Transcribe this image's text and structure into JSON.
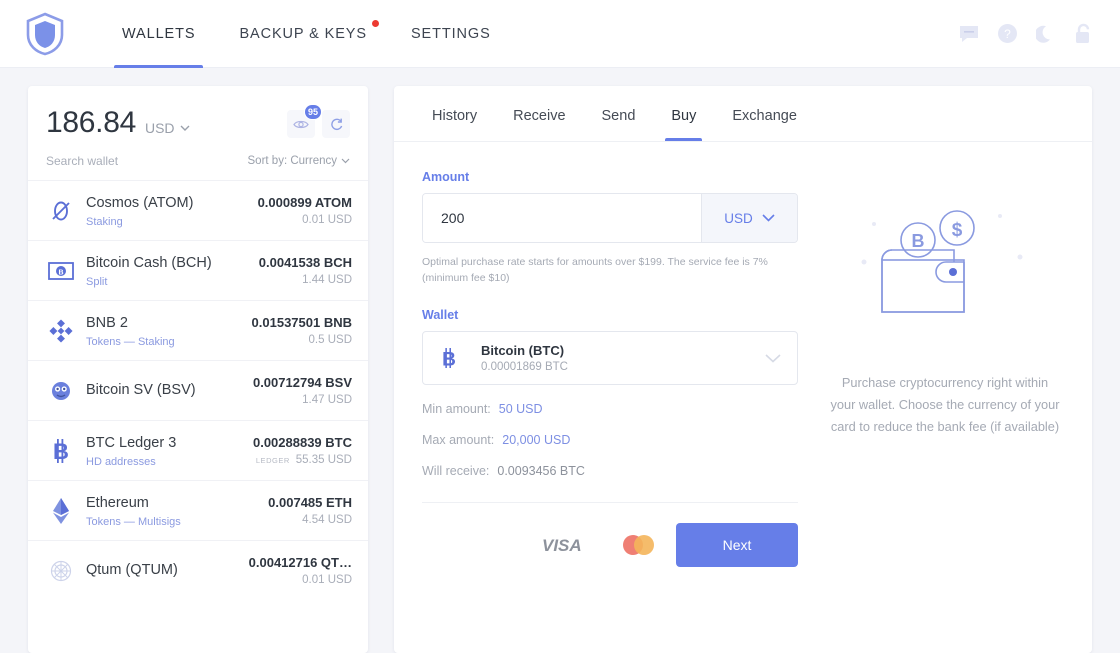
{
  "header": {
    "logo_name": "shield-logo",
    "nav": [
      {
        "label": "WALLETS",
        "active": true,
        "dot": false
      },
      {
        "label": "BACKUP & KEYS",
        "active": false,
        "dot": true
      },
      {
        "label": "SETTINGS",
        "active": false,
        "dot": false
      }
    ],
    "icons": [
      "chat-icon",
      "help-icon",
      "moon-icon",
      "unlock-icon"
    ]
  },
  "sidebar": {
    "balance": "186.84",
    "balance_currency": "USD",
    "eye_badge": "95",
    "search_placeholder": "Search wallet",
    "sort_label": "Sort by: Currency",
    "wallets": [
      {
        "icon": "cosmos-icon",
        "name": "Cosmos (ATOM)",
        "sub": "Staking",
        "amount": "0.000899 ATOM",
        "usd": "0.01 USD",
        "tag": ""
      },
      {
        "icon": "bitcoin-cash-icon",
        "name": "Bitcoin Cash (BCH)",
        "sub": "Split",
        "amount": "0.0041538 BCH",
        "usd": "1.44 USD",
        "tag": ""
      },
      {
        "icon": "binance-icon",
        "name": "BNB 2",
        "sub": "Tokens — Staking",
        "amount": "0.01537501 BNB",
        "usd": "0.5 USD",
        "tag": ""
      },
      {
        "icon": "bitcoin-sv-icon",
        "name": "Bitcoin SV (BSV)",
        "sub": "",
        "amount": "0.00712794 BSV",
        "usd": "1.47 USD",
        "tag": ""
      },
      {
        "icon": "bitcoin-icon",
        "name": "BTC Ledger 3",
        "sub": "HD addresses",
        "amount": "0.00288839 BTC",
        "usd": "55.35 USD",
        "tag": "LEDGER"
      },
      {
        "icon": "ethereum-icon",
        "name": "Ethereum",
        "sub": "Tokens — Multisigs",
        "amount": "0.007485 ETH",
        "usd": "4.54 USD",
        "tag": ""
      },
      {
        "icon": "qtum-icon",
        "name": "Qtum (QTUM)",
        "sub": "",
        "amount": "0.00412716 QT…",
        "usd": "0.01 USD",
        "tag": ""
      }
    ]
  },
  "main": {
    "tabs": [
      {
        "label": "History",
        "active": false
      },
      {
        "label": "Receive",
        "active": false
      },
      {
        "label": "Send",
        "active": false
      },
      {
        "label": "Buy",
        "active": true
      },
      {
        "label": "Exchange",
        "active": false
      }
    ],
    "amount_label": "Amount",
    "amount_value": "200",
    "amount_placeholder": "0",
    "currency": "USD",
    "hint": "Optimal purchase rate starts for amounts over $199. The service fee is 7% (minimum fee $10)",
    "wallet_label": "Wallet",
    "wallet_name": "Bitcoin (BTC)",
    "wallet_balance": "0.00001869 BTC",
    "info": [
      {
        "key": "Min amount:",
        "value": "50 USD",
        "style": "link"
      },
      {
        "key": "Max amount:",
        "value": "20,000 USD",
        "style": "link"
      },
      {
        "key": "Will receive:",
        "value": "0.0093456 BTC",
        "style": "plain"
      }
    ],
    "payment_icons": [
      "visa-logo",
      "mastercard-logo"
    ],
    "next_label": "Next",
    "promo_text": "Purchase cryptocurrency right within your wallet. Choose the currency of your card to reduce the bank fee (if available)"
  },
  "colors": {
    "accent": "#667ee8",
    "dot": "#ec3a31",
    "background": "#f4f5f9"
  }
}
